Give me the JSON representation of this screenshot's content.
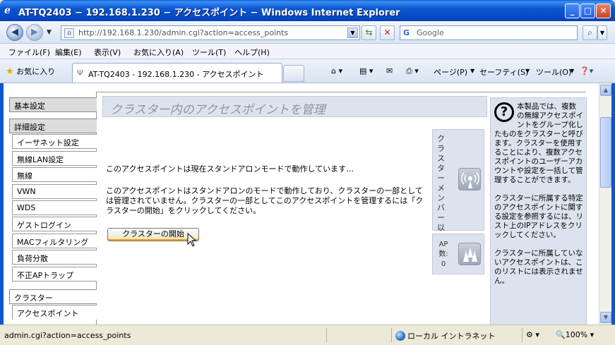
{
  "window": {
    "title": "AT-TQ2403 − 192.168.1.230 − アクセスポイント − Windows Internet Explorer",
    "minimize": "_",
    "maximize": "□",
    "close": "✕"
  },
  "address_bar": {
    "url": "http://192.168.1.230/admin.cgi?action=access_points",
    "search_placeholder": "Google"
  },
  "menu": [
    "ファイル(F)",
    "編集(E)",
    "表示(V)",
    "お気に入り(A)",
    "ツール(T)",
    "ヘルプ(H)"
  ],
  "toolbar": {
    "favorites_label": "お気に入り",
    "tab_label": "AT-TQ2403 - 192.168.1.230 - アクセスポイント",
    "page_label": "ページ(P)",
    "safety_label": "セーフティ(S)",
    "tools_label": "ツール(O)"
  },
  "sidebar": {
    "basic": "基本設定",
    "advanced": "詳細設定",
    "advanced_items": [
      "イーサネット設定",
      "無線LAN設定",
      "無線",
      "VWN",
      "WDS",
      "ゲストログイン",
      "MACフィルタリング",
      "負荷分散",
      "不正APトラップ"
    ],
    "cluster": "クラスター",
    "cluster_items": [
      "アクセスポイント"
    ]
  },
  "main": {
    "title": "クラスター内のアクセスポイントを管理",
    "status_message": "このアクセスポイントは現在スタンドアロンモードで動作しています…",
    "explanation": "このアクセスポイントはスタンドアロンのモードで動作しており、クラスターの一部としては管理されていません。クラスターの一部としてこのアクセスポイントを管理するには「クラスターの開始」をクリックしてください。",
    "start_button": "クラスターの開始"
  },
  "cluster_panel": {
    "label": "クラスターメンバー以外",
    "ap_count_label": "AP数:",
    "ap_count": "0"
  },
  "help": {
    "para1": "本製品では、複数の無線アクセスポイントをグループ化したものをクラスターと呼びます。クラスターを使用することにより、複数アクセスポイントのユーザーアカウントや設定を一括して管理することができます。",
    "para2": "クラスターに所属する特定のアクセスポイントに関する設定を参照するには、リスト上のIPアドレスをクリックしてください。",
    "para3": "クラスターに所属していないアクセスポイントは、このリストには表示されません。"
  },
  "statusbar": {
    "url": "admin.cgi?action=access_points",
    "zone": "ローカル イントラネット",
    "zoom": "100%"
  }
}
